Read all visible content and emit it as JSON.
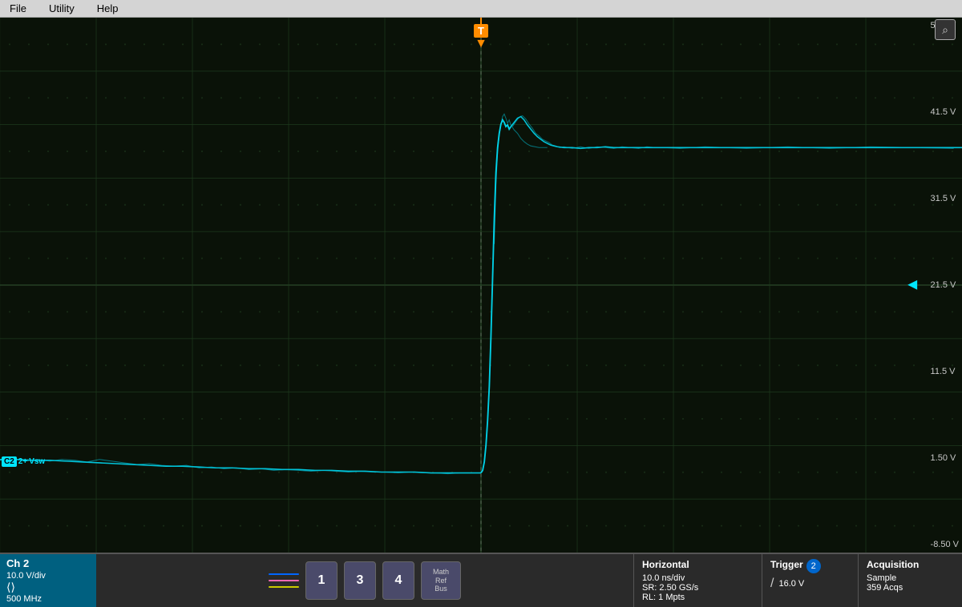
{
  "menubar": {
    "items": [
      "File",
      "Utility",
      "Help"
    ]
  },
  "scope": {
    "voltage_labels": [
      "51.5 V",
      "41.5 V",
      "31.5 V",
      "21.5 V",
      "11.5 V",
      "1.50 V",
      "-8.50 V"
    ],
    "trigger_voltage": "T",
    "ch2_label": "C2",
    "vsw_label": "Vsw",
    "ground_arrow": "◄"
  },
  "bottom": {
    "ch2_title": "Ch 2",
    "ch2_vdiv": "10.0 V/div",
    "ch2_bw": "500 MHz",
    "ch1_btn": "1",
    "ch3_btn": "3",
    "ch4_btn": "4",
    "math_ref_bus": "Math\nRef\nBus",
    "horizontal_title": "Horizontal",
    "horizontal_nsdiv": "10.0 ns/div",
    "horizontal_sr": "SR: 2.50 GS/s",
    "horizontal_rl": "RL: 1 Mpts",
    "trigger_title": "Trigger",
    "trigger_num": "2",
    "trigger_slope": "/",
    "trigger_voltage_val": "16.0  V",
    "acquisition_title": "Acquisition",
    "acquisition_mode": "Sample",
    "acquisition_acqs": "359 Acqs"
  },
  "colors": {
    "ch2": "#00e5ff",
    "ch1_line": "#0066ff",
    "ch3_line": "#ff69b4",
    "ch4_line": "#cccc00",
    "accent": "#00e5ff",
    "trigger_orange": "#ff8c00",
    "grid": "#1e3a1e"
  }
}
